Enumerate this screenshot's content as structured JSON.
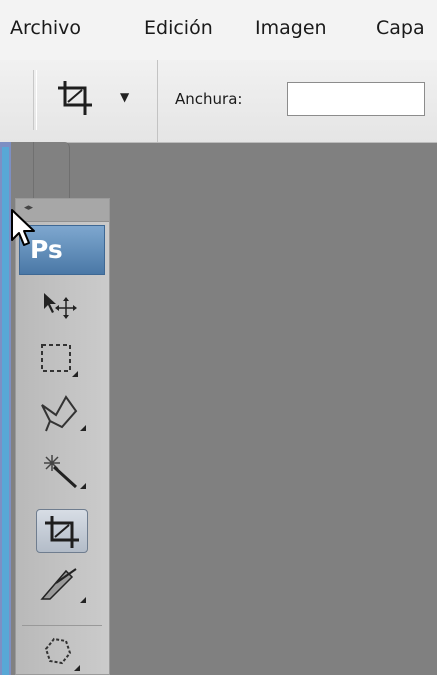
{
  "menu": {
    "items": [
      "Archivo",
      "Edición",
      "Imagen",
      "Capa"
    ]
  },
  "options_bar": {
    "tool_icon": "crop-icon",
    "width_label": "Anchura:",
    "width_value": ""
  },
  "toolbox": {
    "logo_text": "Ps",
    "tools": [
      {
        "name": "move-tool",
        "icon": "move-icon",
        "active": false
      },
      {
        "name": "marquee-tool",
        "icon": "rect-marquee-icon",
        "active": false
      },
      {
        "name": "lasso-tool",
        "icon": "lasso-icon",
        "active": false
      },
      {
        "name": "magic-wand-tool",
        "icon": "magic-wand-icon",
        "active": false
      },
      {
        "name": "crop-tool",
        "icon": "crop-icon",
        "active": true
      },
      {
        "name": "slice-tool",
        "icon": "slice-icon",
        "active": false
      },
      {
        "name": "healing-tool",
        "icon": "healing-brush-icon",
        "active": false
      }
    ]
  },
  "colors": {
    "canvas": "#808080",
    "menubar": "#f3f3f3",
    "toolbox": "#c4c4c4",
    "ps_logo": "#5b88b5",
    "accent_strip": "#58a8d6"
  }
}
